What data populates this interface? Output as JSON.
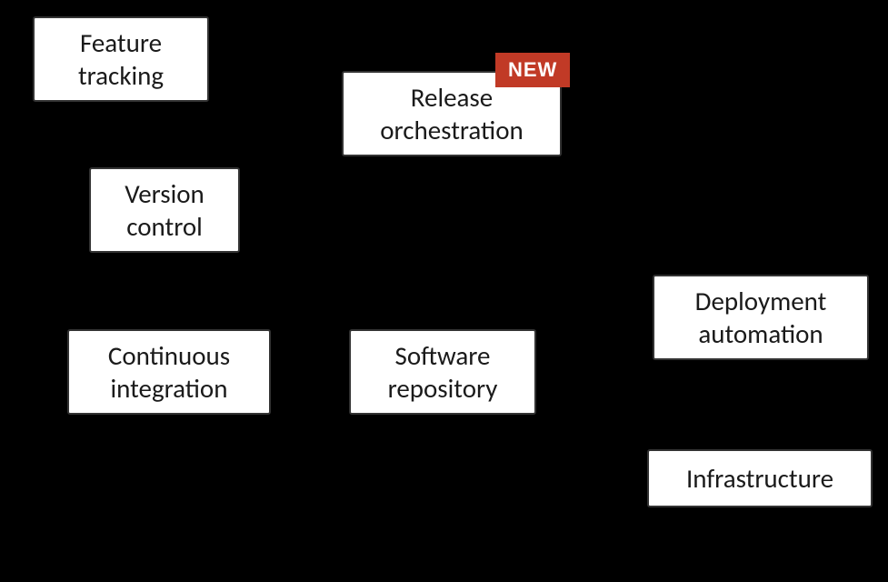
{
  "boxes": {
    "feature_tracking": "Feature tracking",
    "release_orchestration": "Release orchestration",
    "version_control": "Version control",
    "continuous_integration": "Continuous integration",
    "software_repository": "Software repository",
    "deployment_automation": "Deployment automation",
    "infrastructure": "Infrastructure"
  },
  "badge": {
    "new": "NEW"
  }
}
